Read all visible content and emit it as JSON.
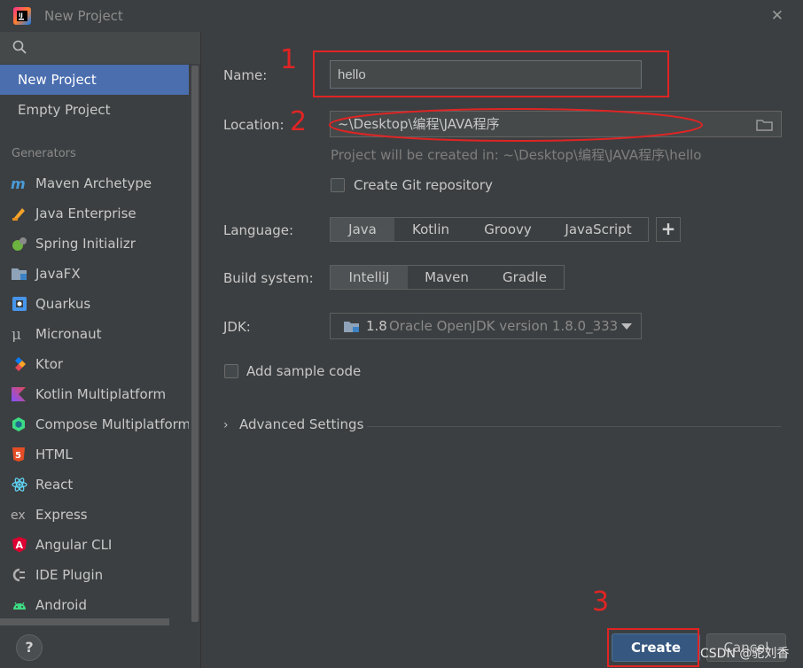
{
  "window": {
    "title": "New Project",
    "close_glyph": "✕"
  },
  "sidebar": {
    "search_icon": "search-icon",
    "top_items": [
      {
        "label": "New Project",
        "selected": true
      },
      {
        "label": "Empty Project",
        "selected": false
      }
    ],
    "generators_header": "Generators",
    "generators": [
      {
        "label": "Maven Archetype",
        "icon": "maven-icon"
      },
      {
        "label": "Java Enterprise",
        "icon": "java-enterprise-icon"
      },
      {
        "label": "Spring Initializr",
        "icon": "spring-icon"
      },
      {
        "label": "JavaFX",
        "icon": "javafx-icon"
      },
      {
        "label": "Quarkus",
        "icon": "quarkus-icon"
      },
      {
        "label": "Micronaut",
        "icon": "micronaut-icon"
      },
      {
        "label": "Ktor",
        "icon": "ktor-icon"
      },
      {
        "label": "Kotlin Multiplatform",
        "icon": "kotlin-icon"
      },
      {
        "label": "Compose Multiplatform",
        "icon": "compose-icon"
      },
      {
        "label": "HTML",
        "icon": "html5-icon"
      },
      {
        "label": "React",
        "icon": "react-icon"
      },
      {
        "label": "Express",
        "icon": "express-icon"
      },
      {
        "label": "Angular CLI",
        "icon": "angular-icon"
      },
      {
        "label": "IDE Plugin",
        "icon": "plugin-icon"
      },
      {
        "label": "Android",
        "icon": "android-icon"
      }
    ],
    "help_label": "?"
  },
  "form": {
    "name_label": "Name:",
    "name_value": "hello",
    "location_label": "Location:",
    "location_value": "~\\Desktop\\编程\\JAVA程序",
    "location_hint": "Project will be created in: ~\\Desktop\\编程\\JAVA程序\\hello",
    "git_label": "Create Git repository",
    "git_checked": false,
    "language_label": "Language:",
    "languages": [
      {
        "label": "Java",
        "active": true
      },
      {
        "label": "Kotlin",
        "active": false
      },
      {
        "label": "Groovy",
        "active": false
      },
      {
        "label": "JavaScript",
        "active": false
      }
    ],
    "add_language_label": "+",
    "build_label": "Build system:",
    "build_systems": [
      {
        "label": "IntelliJ",
        "active": true
      },
      {
        "label": "Maven",
        "active": false
      },
      {
        "label": "Gradle",
        "active": false
      }
    ],
    "jdk_label": "JDK:",
    "jdk_version": "1.8",
    "jdk_desc": "Oracle OpenJDK version 1.8.0_333",
    "sample_label": "Add sample code",
    "sample_checked": false,
    "advanced_label": "Advanced Settings",
    "advanced_chevron": "›"
  },
  "footer": {
    "create_label": "Create",
    "cancel_label": "Cancel"
  },
  "annotations": {
    "n1": "1",
    "n2": "2",
    "n3": "3",
    "color": "#e02424"
  },
  "watermark": "CSDN @驼刘香",
  "colors": {
    "accent": "#4b6eaf",
    "primary_button": "#365880",
    "background": "#3c3f41"
  }
}
